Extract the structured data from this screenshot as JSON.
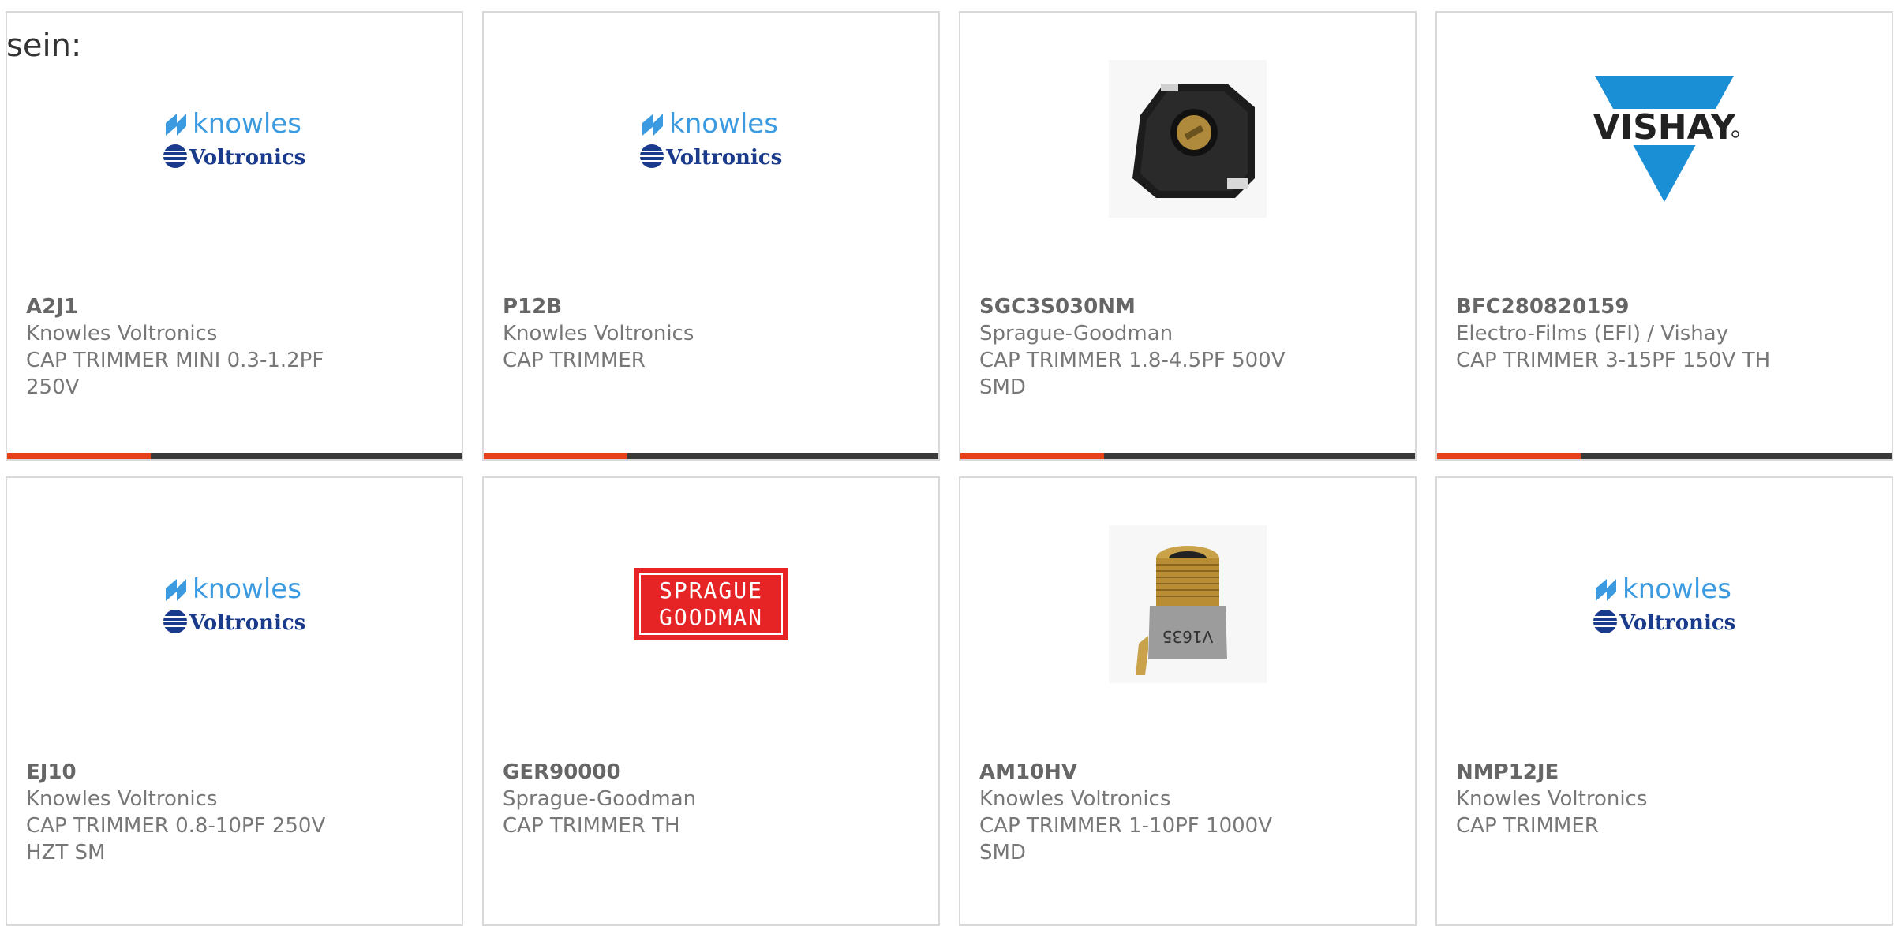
{
  "intro_text": "sein:",
  "colors": {
    "accent": "#e8401c",
    "bar": "#3a3a3a",
    "border": "#d9d9d9",
    "knowles_blue": "#3c9be0",
    "voltronics_navy": "#1a3b8c",
    "vishay_blue": "#1b8fd6",
    "sprague_red": "#e62426"
  },
  "products": [
    {
      "part_number": "A2J1",
      "manufacturer": "Knowles Voltronics",
      "description": "CAP TRIMMER MINI 0.3-1.2PF 250V",
      "image": "knowles-voltronics-logo"
    },
    {
      "part_number": "P12B",
      "manufacturer": "Knowles Voltronics",
      "description": "CAP TRIMMER",
      "image": "knowles-voltronics-logo"
    },
    {
      "part_number": "SGC3S030NM",
      "manufacturer": "Sprague-Goodman",
      "description": "CAP TRIMMER 1.8-4.5PF 500V SMD",
      "image": "smd-trimmer-photo"
    },
    {
      "part_number": "BFC280820159",
      "manufacturer": "Electro-Films (EFI) / Vishay",
      "description": "CAP TRIMMER 3-15PF 150V TH",
      "image": "vishay-logo"
    },
    {
      "part_number": "EJ10",
      "manufacturer": "Knowles Voltronics",
      "description": "CAP TRIMMER 0.8-10PF 250V HZT SM",
      "image": "knowles-voltronics-logo"
    },
    {
      "part_number": "GER90000",
      "manufacturer": "Sprague-Goodman",
      "description": "CAP TRIMMER TH",
      "image": "sprague-goodman-logo"
    },
    {
      "part_number": "AM10HV",
      "manufacturer": "Knowles Voltronics",
      "description": "CAP TRIMMER 1-10PF 1000V SMD",
      "image": "piston-trimmer-photo"
    },
    {
      "part_number": "NMP12JE",
      "manufacturer": "Knowles Voltronics",
      "description": "CAP TRIMMER",
      "image": "knowles-voltronics-logo"
    }
  ],
  "logos": {
    "knowles": "knowles",
    "voltronics": "Voltronics",
    "vishay": "VISHAY",
    "sprague_line1": "SPRAGUE",
    "sprague_line2": "GOODMAN",
    "piston_marking": "V1635"
  }
}
